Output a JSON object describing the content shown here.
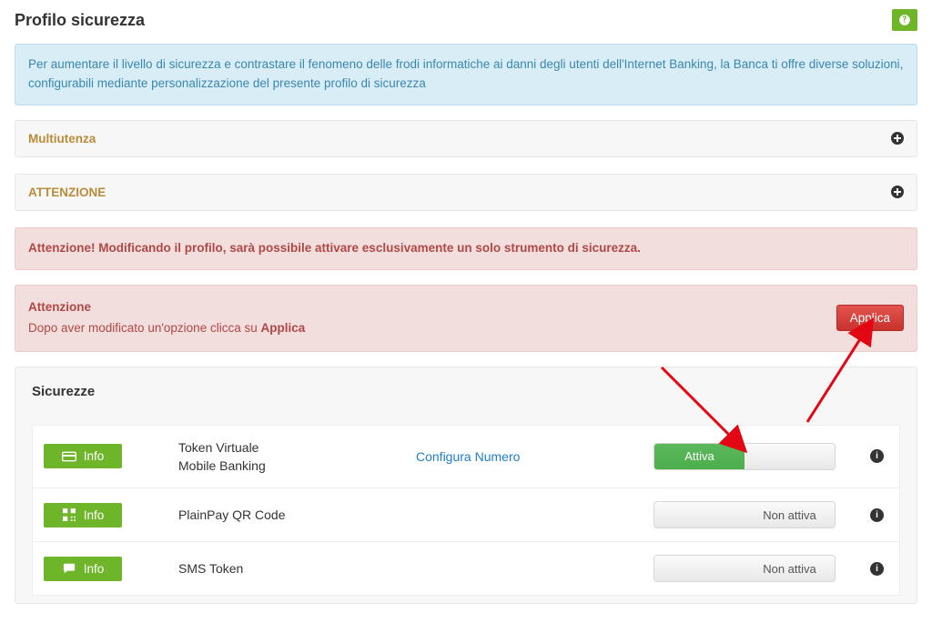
{
  "page": {
    "title": "Profilo sicurezza"
  },
  "infoAlert": "Per aumentare il livello di sicurezza e contrastare il fenomeno delle frodi informatiche ai danni degli utenti dell'Internet Banking, la Banca ti offre diverse soluzioni, configurabili mediante personalizzazione del presente profilo di sicurezza",
  "panels": {
    "multiutenza": "Multiutenza",
    "attenzione": "ATTENZIONE"
  },
  "dangerAlert": "Attenzione! Modificando il profilo, sarà possibile attivare esclusivamente un solo strumento di sicurezza.",
  "applyAlert": {
    "title": "Attenzione",
    "text_prefix": "Dopo aver modificato un'opzione clicca su ",
    "text_bold": "Applica",
    "button": "Applica"
  },
  "sicurezze": {
    "heading": "Sicurezze",
    "info_label": "Info",
    "rows": [
      {
        "label_line1": "Token Virtuale",
        "label_line2": "Mobile Banking",
        "config_link": "Configura Numero",
        "toggle_active": "Attiva",
        "toggle_inactive": ""
      },
      {
        "label_line1": "PlainPay QR Code",
        "label_line2": "",
        "config_link": "",
        "toggle_active": "",
        "toggle_inactive": "Non attiva"
      },
      {
        "label_line1": "SMS Token",
        "label_line2": "",
        "config_link": "",
        "toggle_active": "",
        "toggle_inactive": "Non attiva"
      }
    ]
  }
}
